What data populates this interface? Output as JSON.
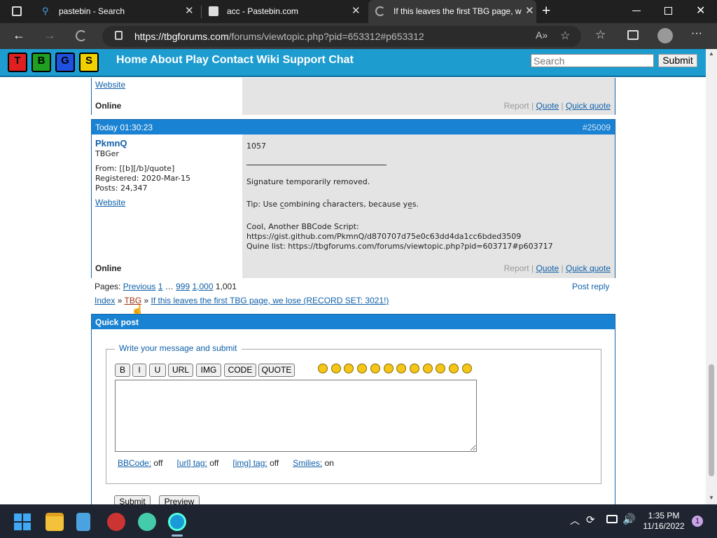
{
  "browser": {
    "tabs": [
      {
        "title": "pastebin - Search",
        "icon": "search-icon",
        "active": false
      },
      {
        "title": "acc - Pastebin.com",
        "icon": "pastebin-icon",
        "active": false
      },
      {
        "title": "If this leaves the first TBG page, w",
        "icon": "loading-icon",
        "active": true
      }
    ],
    "url_host": "https://tbgforums.com",
    "url_path": "/forums/viewtopic.php?pid=653312#p653312"
  },
  "site": {
    "logo_letters": [
      "T",
      "B",
      "G",
      "S"
    ],
    "logo_colors": [
      "#e02020",
      "#20a020",
      "#2050e0",
      "#f0d000"
    ],
    "nav": [
      "Home",
      "About",
      "Play",
      "Contact",
      "Wiki",
      "Support",
      "Chat"
    ],
    "search_placeholder": "Search",
    "search_button": "Submit"
  },
  "prev_post": {
    "website": "Website",
    "status": "Online",
    "actions": {
      "report": "Report",
      "quote": "Quote",
      "quick_quote": "Quick quote"
    }
  },
  "post": {
    "time": "Today 01:30:23",
    "number": "#25009",
    "author": "PkmnQ",
    "rank": "TBGer",
    "from": "From: [[b][/b]/quote]",
    "registered": "Registered: 2020-Mar-15",
    "posts": "Posts: 24,347",
    "website": "Website",
    "status": "Online",
    "message": "1057",
    "sig1": "Signature temporarily removed.",
    "sig2": "Tip: Use c̲ombining ch̑aracters, because ye̲s.",
    "sig3": "Cool, Another BBCode Script:",
    "sig4": "https://gist.github.com/PkmnQ/d870707d75e0c63dd4da1cc6bded3509",
    "sig5": "Quine list: https://tbgforums.com/forums/viewtopic.php?pid=603717#p603717",
    "actions": {
      "report": "Report",
      "quote": "Quote",
      "quick_quote": "Quick quote"
    }
  },
  "pagination": {
    "label": "Pages:",
    "previous": "Previous",
    "first": "1",
    "ellipsis": "…",
    "p999": "999",
    "p1000": "1,000",
    "current": "1,001",
    "post_reply": "Post reply"
  },
  "breadcrumb": {
    "index": "Index",
    "forum": "TBG",
    "topic": "If this leaves the first TBG page, we lose (RECORD SET: 3021!)"
  },
  "quickpost": {
    "title": "Quick post",
    "legend": "Write your message and submit",
    "buttons": [
      "B",
      "I",
      "U",
      "URL",
      "IMG",
      "CODE",
      "QUOTE"
    ],
    "smiley_count": 12,
    "bbcode_label": "BBCode:",
    "bbcode_val": "off",
    "urltag_label": "[url] tag:",
    "urltag_val": "off",
    "imgtag_label": "[img] tag:",
    "imgtag_val": "off",
    "smilies_label": "Smilies:",
    "smilies_val": "on",
    "submit": "Submit",
    "preview": "Preview"
  },
  "taskbar": {
    "time": "1:35 PM",
    "date": "11/16/2022",
    "notifications": "1"
  },
  "colors": {
    "header_blue": "#1d9ccf",
    "post_head": "#1a82d2",
    "link": "#1060a8"
  }
}
